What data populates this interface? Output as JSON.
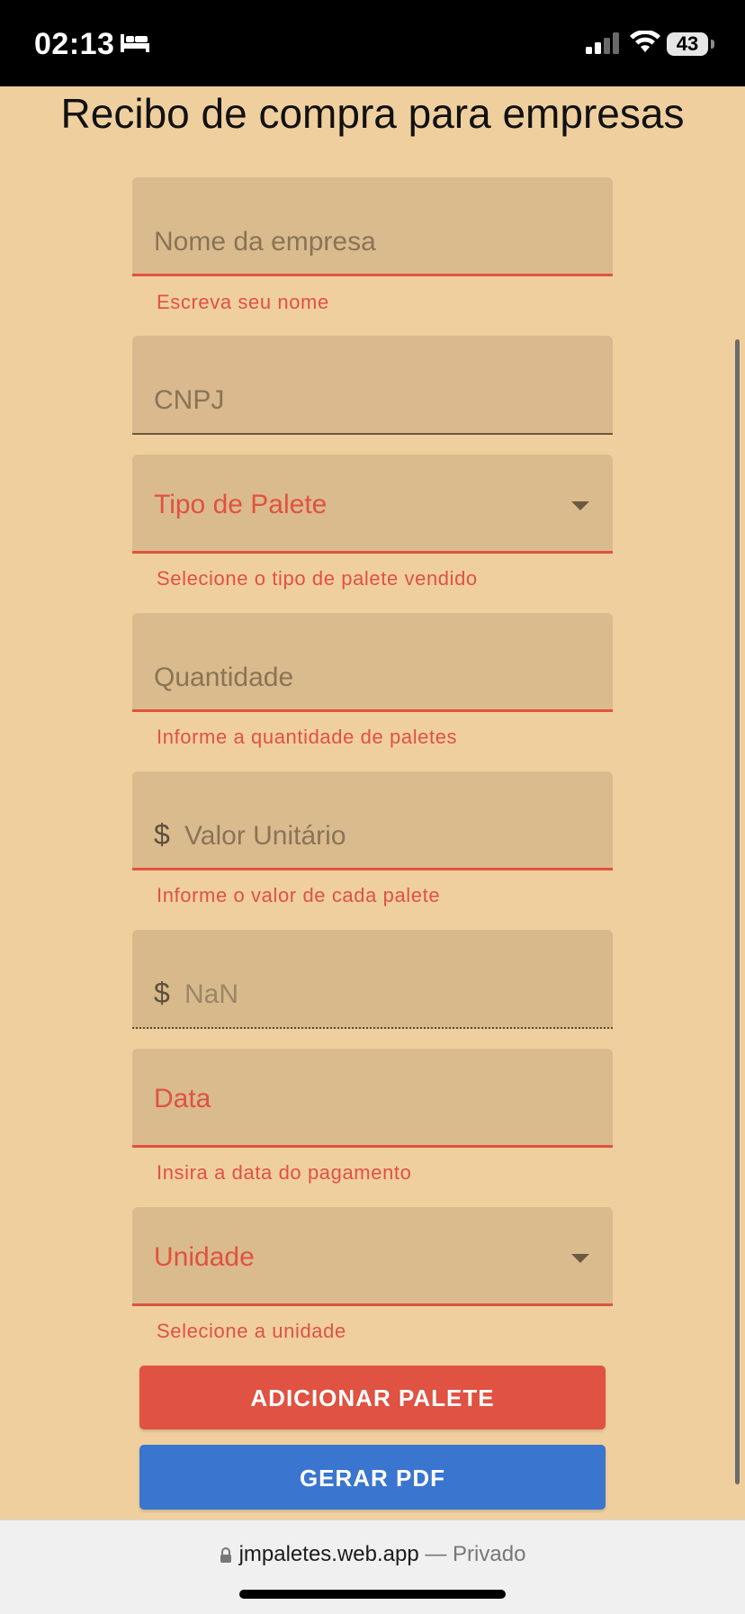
{
  "status_bar": {
    "time": "02:13",
    "battery": "43",
    "icons": [
      "bed-icon",
      "signal-icon",
      "wifi-icon",
      "battery-icon"
    ]
  },
  "page": {
    "title": "Recibo de compra para empresas"
  },
  "form": {
    "nome_label": "Nome da empresa",
    "nome_helper": "Escreva seu nome",
    "cnpj_label": "CNPJ",
    "tipo_label": "Tipo de Palete",
    "tipo_helper": "Selecione o tipo de palete vendido",
    "quantidade_label": "Quantidade",
    "quantidade_helper": "Informe a quantidade de paletes",
    "valor_prefix": "$",
    "valor_label": "Valor Unitário",
    "valor_helper": "Informe o valor de cada palete",
    "total_prefix": "$",
    "total_value": "NaN",
    "data_label": "Data",
    "data_helper": "Insira a data do pagamento",
    "unidade_label": "Unidade",
    "unidade_helper": "Selecione a unidade"
  },
  "buttons": {
    "add_palete": "ADICIONAR PALETE",
    "gerar_pdf": "GERAR PDF"
  },
  "browser": {
    "domain": "jmpaletes.web.app",
    "separator": "—",
    "mode": "Privado"
  },
  "colors": {
    "background": "#f0cf9f",
    "field_bg": "#dabb8e",
    "error": "#e0523f",
    "primary_button": "#e05241",
    "secondary_button": "#3a75d0"
  }
}
